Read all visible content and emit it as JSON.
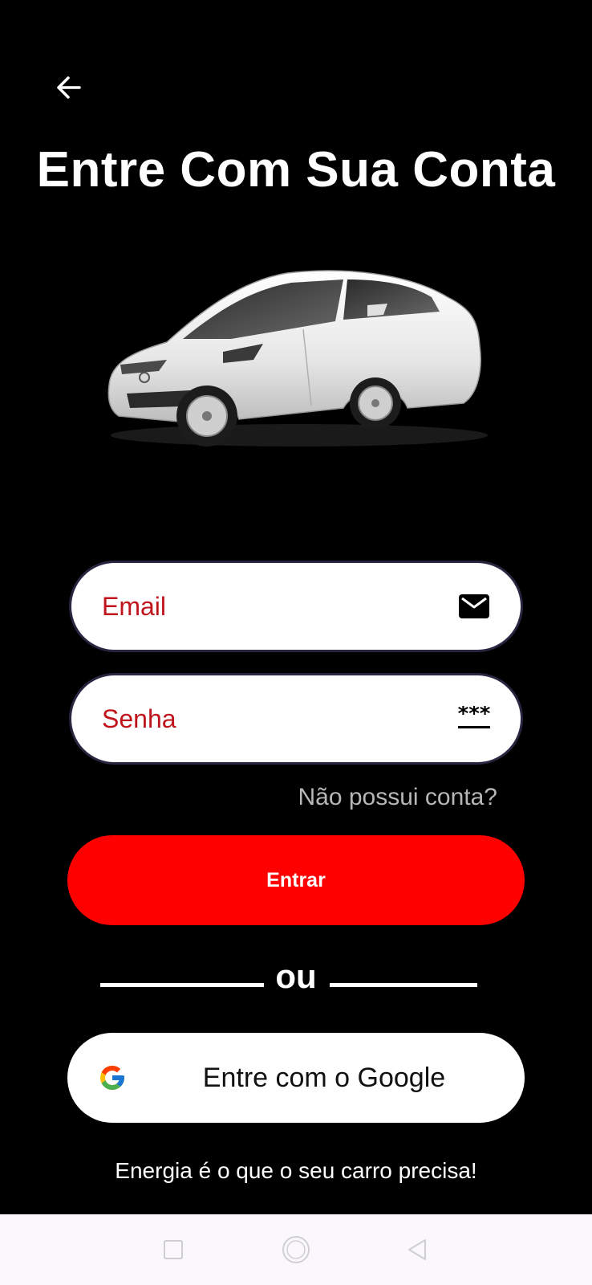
{
  "header": {
    "title": "Entre Com Sua Conta"
  },
  "form": {
    "email_placeholder": "Email",
    "password_placeholder": "Senha",
    "password_icon_text": "***",
    "signup_link": "Não possui conta?",
    "submit_label": "Entrar"
  },
  "divider": {
    "text": "ou"
  },
  "google": {
    "label": "Entre com o Google"
  },
  "footer": {
    "tagline": "Energia é o que o seu carro precisa!"
  },
  "colors": {
    "background": "#000000",
    "accent": "#ff0000",
    "placeholder": "#c0141c",
    "link": "#b7b7b7"
  },
  "icons": {
    "back": "arrow-left-icon",
    "email": "envelope-icon",
    "password": "password-dots-icon",
    "google": "google-g-icon",
    "nav_recent": "square-icon",
    "nav_home": "circle-icon",
    "nav_back": "triangle-back-icon"
  }
}
